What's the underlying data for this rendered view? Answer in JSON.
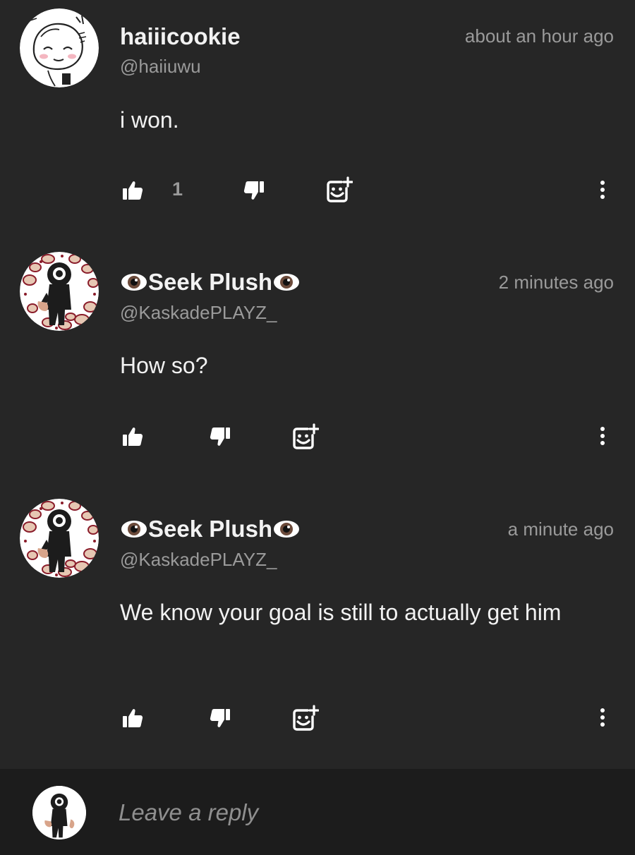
{
  "comments": [
    {
      "display_name": "haiiicookie",
      "handle": "@haiiuwu",
      "time": "about an hour ago",
      "text": "i won.",
      "like_count": "1",
      "avatar_icon": "sketch-avatar-icon"
    },
    {
      "display_name": "Seek Plush",
      "handle": "@KaskadePLAYZ_",
      "time": "2 minutes ago",
      "text": "How so?",
      "like_count": "",
      "avatar_icon": "seek-plush-avatar-icon"
    },
    {
      "display_name": "Seek Plush",
      "handle": "@KaskadePLAYZ_",
      "time": "a minute ago",
      "text": "We know your goal is still to actually get him",
      "like_count": "",
      "avatar_icon": "seek-plush-avatar-icon"
    }
  ],
  "reply": {
    "placeholder": "Leave a reply"
  },
  "colors": {
    "background": "#262626",
    "reply_bar": "#1c1c1c",
    "text": "#f2f2f2",
    "muted": "#9a9a9a"
  },
  "icons": {
    "like": "thumbs-up-icon",
    "dislike": "thumbs-down-icon",
    "react": "add-reaction-icon",
    "more": "more-vertical-icon",
    "name_decoration": "eye-emoji-icon"
  }
}
